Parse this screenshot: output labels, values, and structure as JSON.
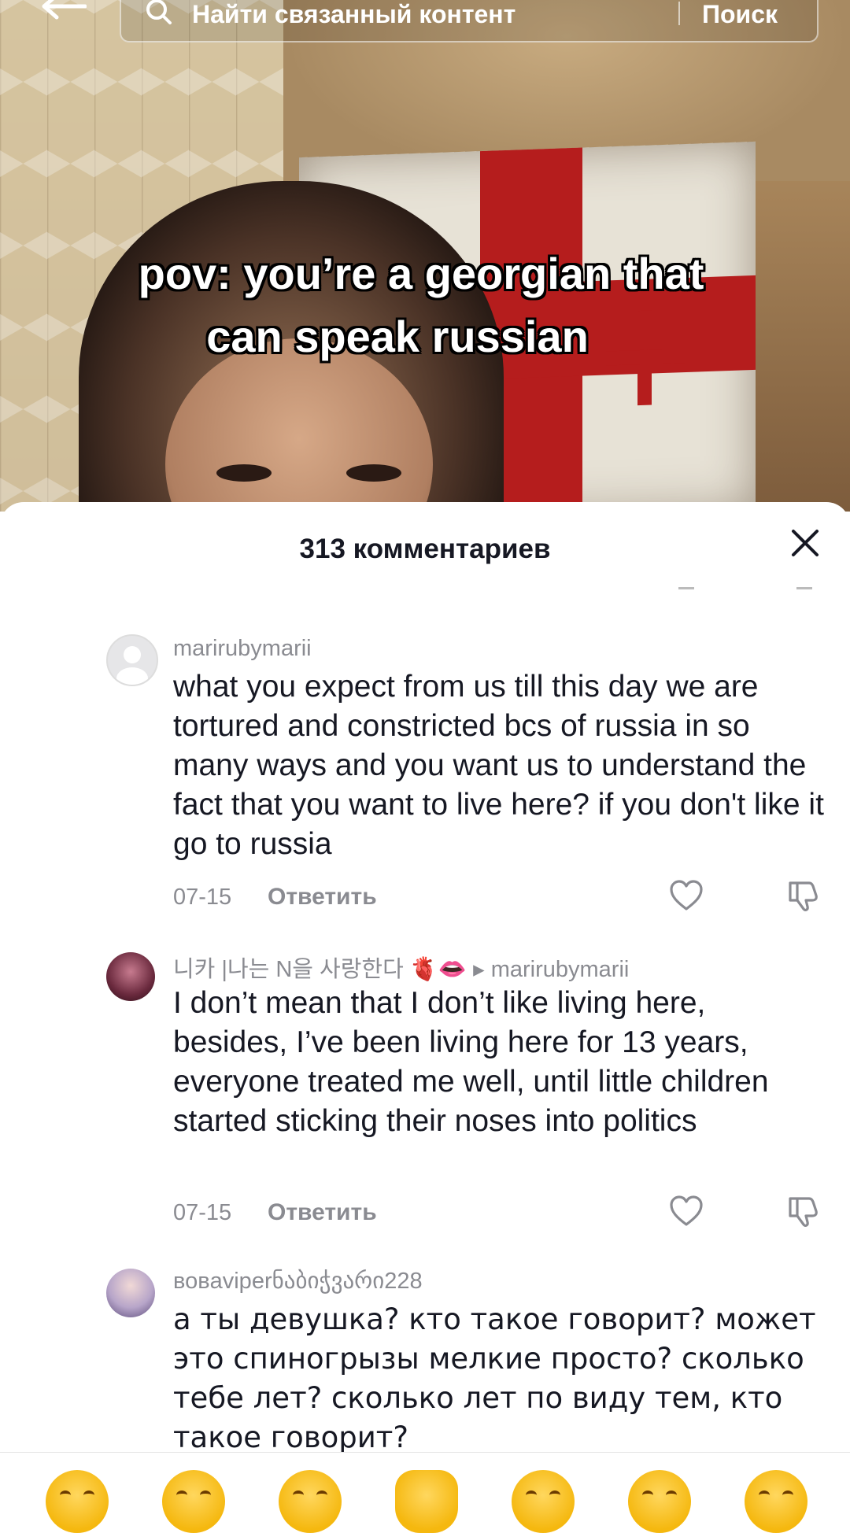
{
  "search": {
    "placeholder": "Найти связанный контент",
    "button": "Поиск"
  },
  "video": {
    "caption_line1": "pov: you’re a georgian that",
    "caption_line2": "can speak russian"
  },
  "comments_sheet": {
    "title": "313 комментариев",
    "comments": [
      {
        "username": "marirubymarii",
        "text": "what you expect from us till this day we are tortured and constricted bcs of russia in so many ways and you want us to understand the fact that you want to live here? if you don't like it go to russia",
        "date": "07-15",
        "reply_label": "Ответить"
      },
      {
        "username": "니카 |나는 N을 사랑한다 🫀👄 ▸ marirubymarii",
        "text": "I don’t mean that I don’t like living here, besides, I’ve been living here for 13 years, everyone treated me well, until little children started sticking their noses into politics",
        "date": "07-15",
        "reply_label": "Ответить"
      },
      {
        "username": "вовaviperნაბიჭვარი228",
        "text": "а ты девушка? кто такое говорит? может это спиногрызы мелкие просто? сколько тебе лет? сколько лет по виду тем, кто такое говорит?"
      }
    ]
  },
  "icons": {
    "back": "back-arrow-icon",
    "search": "search-icon",
    "close": "close-icon",
    "like": "heart-icon",
    "dislike": "thumbs-down-icon"
  }
}
